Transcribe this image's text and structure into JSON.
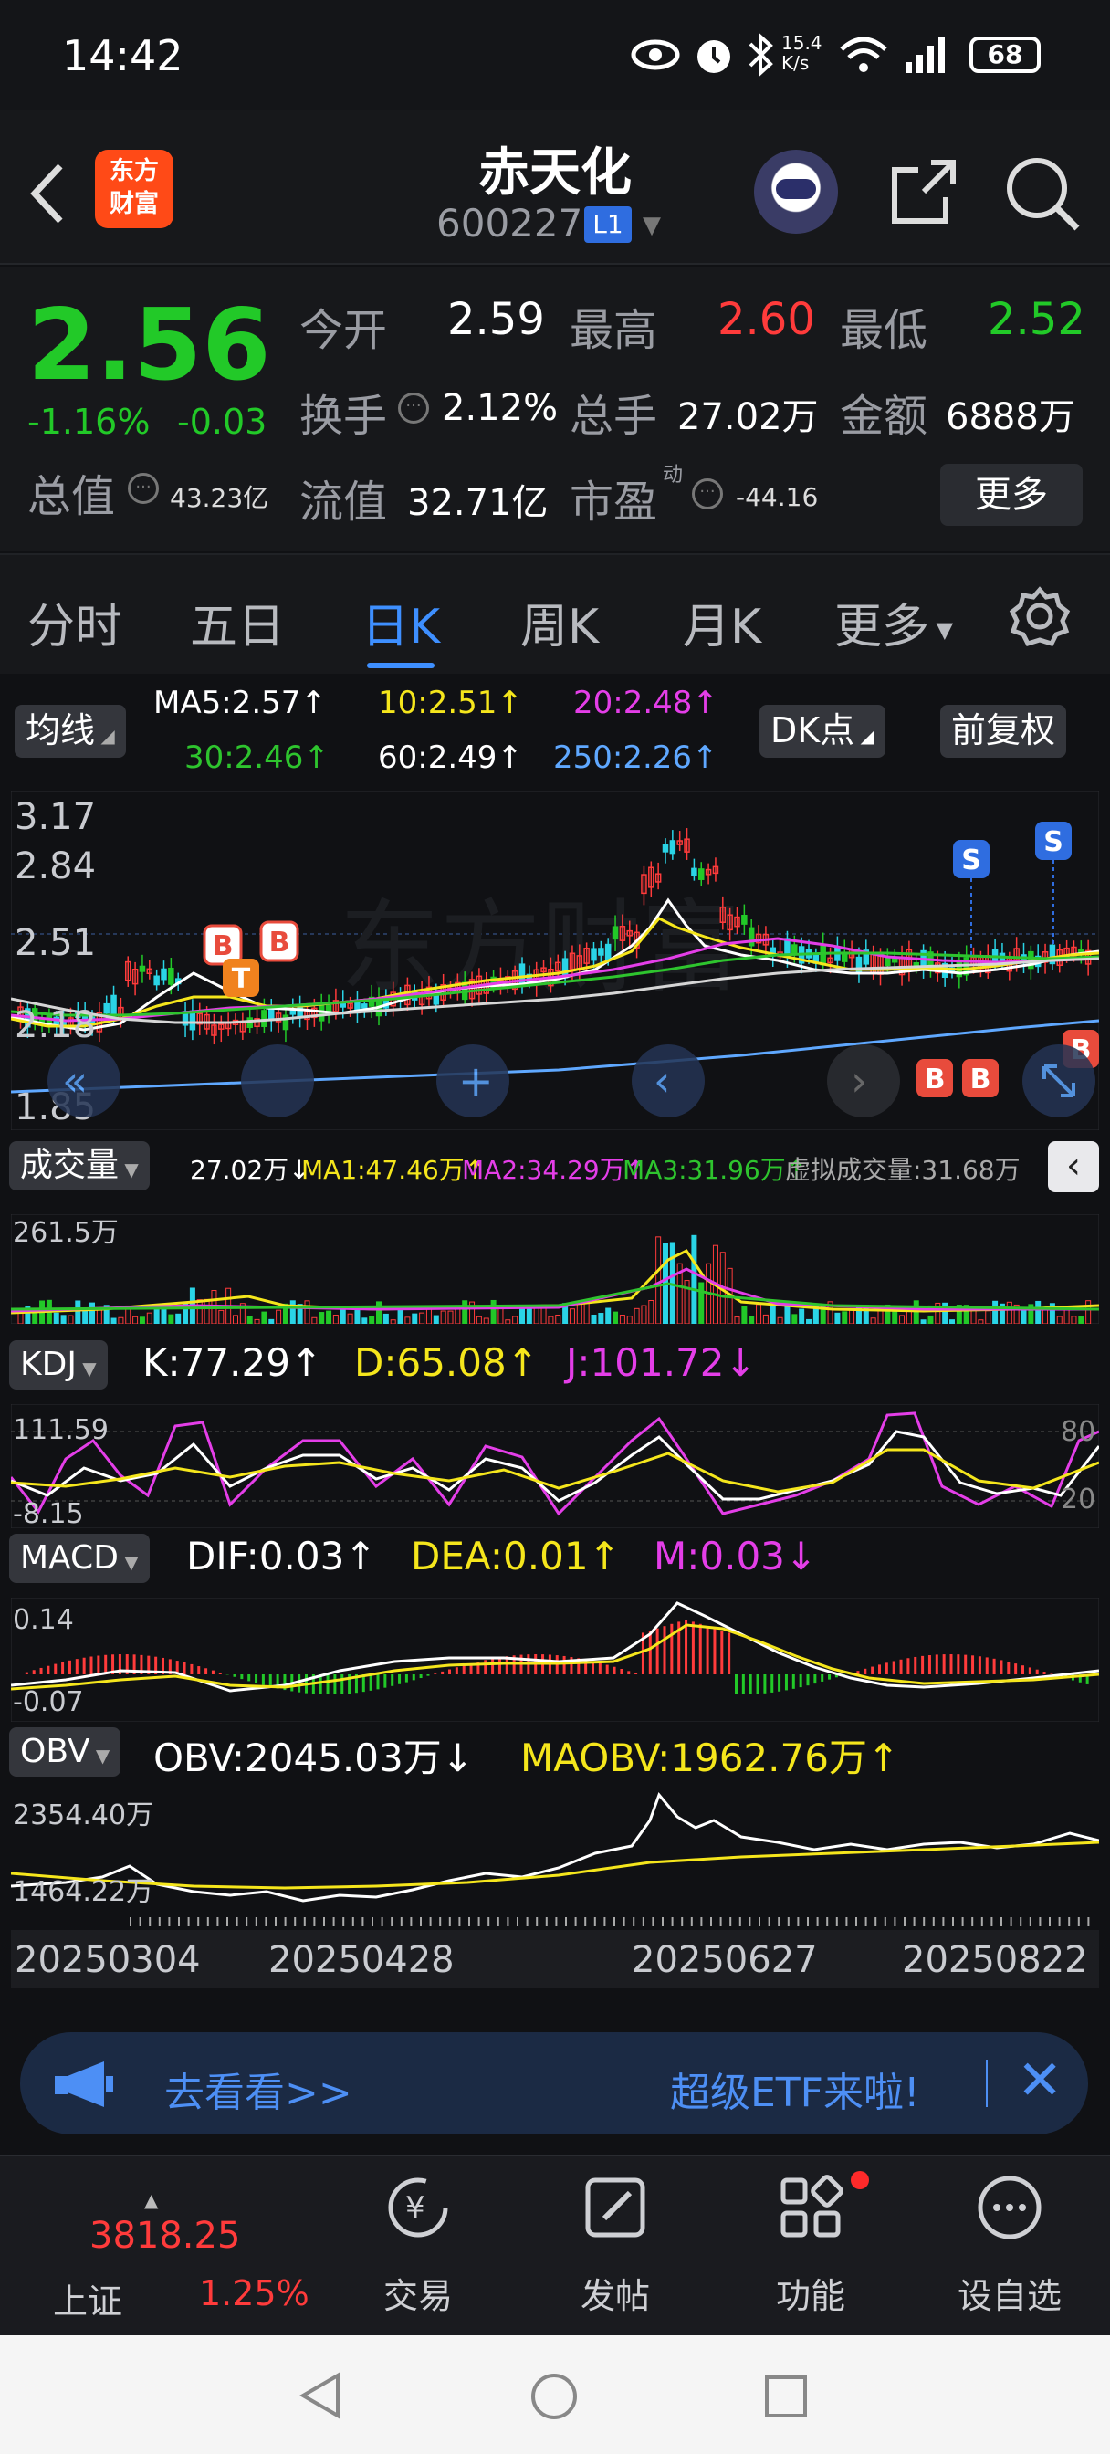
{
  "status": {
    "time": "14:42",
    "net_speed": "15.4\nK/s",
    "battery": "68"
  },
  "header": {
    "name": "赤天化",
    "code": "600227",
    "level": "L1",
    "logo_text": "东方\n财富"
  },
  "quote": {
    "price": "2.56",
    "change_pct": "-1.16%",
    "change": "-0.03",
    "open_label": "今开",
    "open": "2.59",
    "high_label": "最高",
    "high": "2.60",
    "low_label": "最低",
    "low": "2.52",
    "turnover_label": "换手",
    "turnover": "2.12%",
    "volume_label": "总手",
    "volume": "27.02万",
    "amount_label": "金额",
    "amount": "6888万",
    "mktcap_label": "总值",
    "mktcap": "43.23亿",
    "float_label": "流值",
    "float": "32.71亿",
    "pe_label": "市盈",
    "pe_sup": "动",
    "pe": "-44.16",
    "more": "更多"
  },
  "tabs": [
    "分时",
    "五日",
    "日K",
    "周K",
    "月K",
    "更多"
  ],
  "kline": {
    "ma_label": "均线",
    "ma5": "MA5:2.57↑",
    "ma10": "10:2.51↑",
    "ma20": "20:2.48↑",
    "ma30": "30:2.46↑",
    "ma60": "60:2.49↑",
    "ma250": "250:2.26↑",
    "dk": "DK点",
    "adjust": "前复权",
    "y_ticks": [
      "3.17",
      "2.84",
      "2.51",
      "2.18",
      "1.85"
    ],
    "signals": [
      "B",
      "B",
      "T",
      "B",
      "B",
      "S",
      "S",
      "B"
    ]
  },
  "volume": {
    "label": "成交量",
    "vol": "27.02万↓",
    "ma1": "MA1:47.46万↑",
    "ma2": "MA2:34.29万↑",
    "ma3": "MA3:31.96万↑",
    "virtual": "虚拟成交量:31.68万",
    "max": "261.5万"
  },
  "kdj": {
    "label": "KDJ",
    "k": "K:77.29↑",
    "d": "D:65.08↑",
    "j": "J:101.72↓",
    "y_top": "111.59",
    "y_bot": "-8.15",
    "r1": "80",
    "r2": "20"
  },
  "macd": {
    "label": "MACD",
    "dif": "DIF:0.03↑",
    "dea": "DEA:0.01↑",
    "m": "M:0.03↓",
    "y_top": "0.14",
    "y_bot": "-0.07"
  },
  "obv": {
    "label": "OBV",
    "obv": "OBV:2045.03万↓",
    "maobv": "MAOBV:1962.76万↑",
    "y_top": "2354.40万",
    "y_bot": "1464.22万"
  },
  "dates": [
    "20250304",
    "20250428",
    "20250627",
    "20250822"
  ],
  "banner": {
    "left": "去看看>>",
    "right": "超级ETF来啦!"
  },
  "nav": {
    "index_value": "3818.25",
    "index_name": "上证",
    "index_pct": "1.25%",
    "items": [
      "交易",
      "发帖",
      "功能",
      "设自选"
    ]
  },
  "colors": {
    "up": "#ff3b3b",
    "down": "#22c928",
    "accent": "#3e8fff",
    "ma5": "#ffffff",
    "ma10": "#f5e61c",
    "ma20": "#e43ee8",
    "ma30": "#2ec42e",
    "ma250": "#5fa8ff"
  }
}
